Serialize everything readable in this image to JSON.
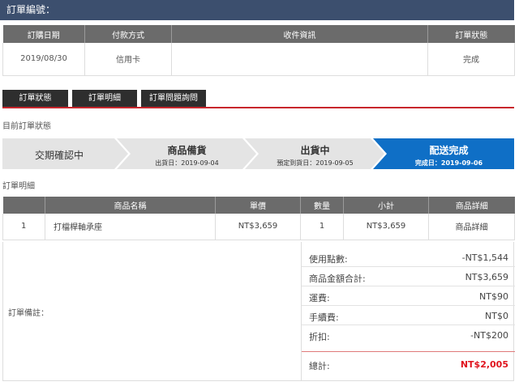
{
  "order_header": {
    "label": "訂單編號："
  },
  "order_info": {
    "headers": [
      "訂購日期",
      "付款方式",
      "收件資訊",
      "訂單狀態"
    ],
    "row": [
      "2019/08/30",
      "信用卡",
      "",
      "完成"
    ]
  },
  "tabs": [
    "訂單狀態",
    "訂單明細",
    "訂單問題詢問"
  ],
  "status_section_label": "目前訂單狀態",
  "progress": {
    "steps": [
      {
        "title": "交期確認中",
        "date": ""
      },
      {
        "title": "商品備貨",
        "date": "出貨日：2019-09-04"
      },
      {
        "title": "出貨中",
        "date": "預定到貨日：2019-09-05"
      },
      {
        "title": "配送完成",
        "date": "完成日：2019-09-06"
      }
    ],
    "active_index": 3,
    "colors": {
      "inactive": "#e4e4e4",
      "active": "#0f6fc6"
    }
  },
  "detail_section_label": "訂單明細",
  "detail": {
    "headers": [
      "",
      "商品名稱",
      "單價",
      "數量",
      "小計",
      "商品詳細"
    ],
    "rows": [
      {
        "index": "1",
        "name": "打檔桿軸承座",
        "price": "NT$3,659",
        "qty": "1",
        "subtotal": "NT$3,659",
        "detail_link": "商品詳細"
      }
    ]
  },
  "remark_label": "訂單備註：",
  "totals": [
    {
      "label": "使用點數:",
      "value": "-NT$1,544"
    },
    {
      "label": "商品金額合計:",
      "value": "NT$3,659"
    },
    {
      "label": "運費:",
      "value": "NT$90"
    },
    {
      "label": "手續費:",
      "value": "NT$0"
    },
    {
      "label": "折扣:",
      "value": "-NT$200"
    }
  ],
  "grand_total": {
    "label": "總計:",
    "value": "NT$2,005",
    "color": "#e0141e"
  }
}
